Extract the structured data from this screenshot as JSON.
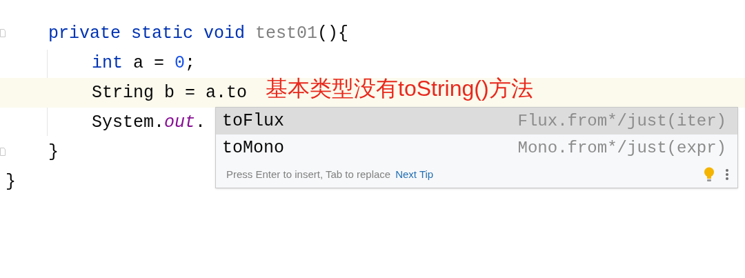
{
  "code": {
    "members": [
      {
        "current": false,
        "tokens": [
          {
            "kind": "keyword",
            "text": "private static void "
          },
          {
            "kind": "unused",
            "text": "test01"
          },
          {
            "kind": "plain",
            "text": "(){"
          }
        ],
        "children": [
          {
            "current": false,
            "tokens": [
              {
                "kind": "keyword",
                "text": "int "
              },
              {
                "kind": "plain",
                "text": "a = "
              },
              {
                "kind": "number",
                "text": "0"
              },
              {
                "kind": "plain",
                "text": ";"
              }
            ]
          },
          {
            "current": true,
            "tokens": [
              {
                "kind": "plain",
                "text": "String b = a.to"
              }
            ]
          },
          {
            "current": false,
            "tokens": [
              {
                "kind": "plain",
                "text": "System."
              },
              {
                "kind": "field",
                "text": "out"
              },
              {
                "kind": "plain",
                "text": "."
              }
            ]
          }
        ],
        "closing": "}"
      }
    ],
    "class_closing": "}"
  },
  "annotation": "基本类型没有toString()方法",
  "completion": {
    "items": [
      {
        "name": "toFlux",
        "hint": "Flux.from*/just(iter)",
        "selected": true
      },
      {
        "name": "toMono",
        "hint": "Mono.from*/just(expr)",
        "selected": false
      }
    ],
    "footer": {
      "text": "Press Enter to insert, Tab to replace",
      "link": "Next Tip"
    }
  }
}
